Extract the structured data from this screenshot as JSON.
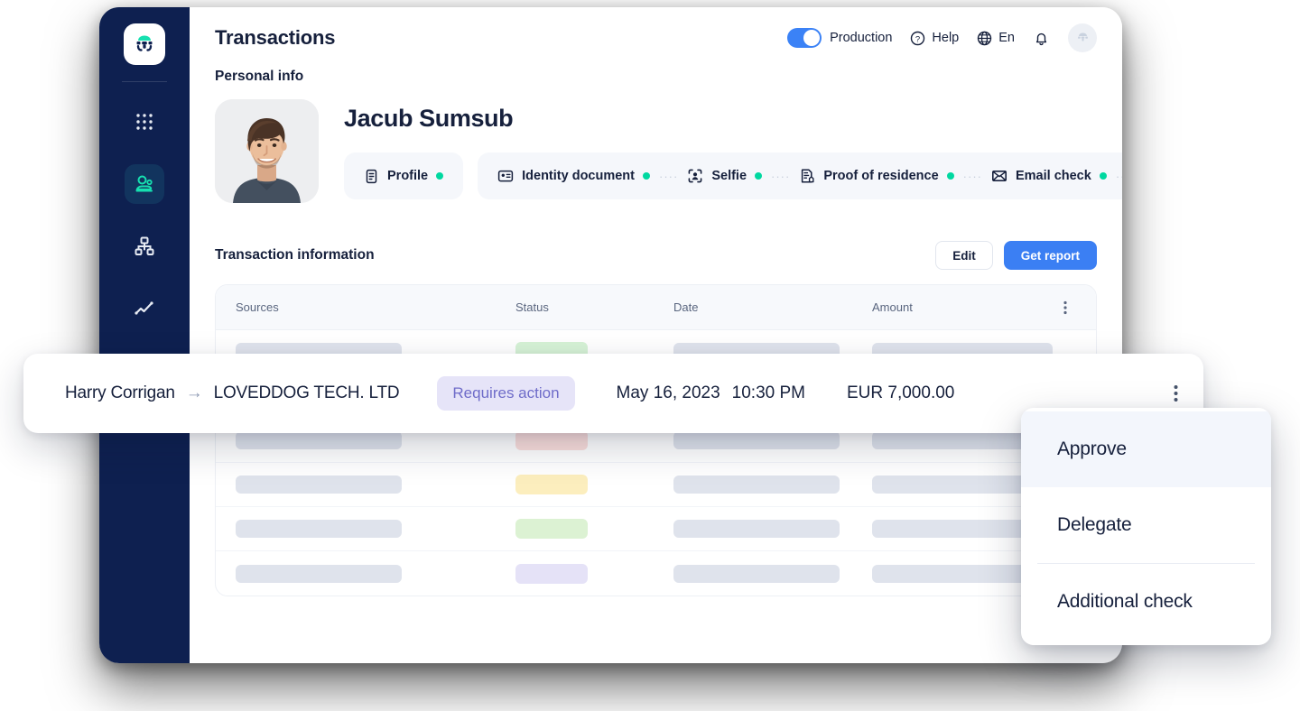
{
  "app": {
    "window_title": "Transactions"
  },
  "sidebar": {
    "logo_name": "sumsub-logo",
    "items": [
      {
        "icon": "apps-grid-icon",
        "name": "sidebar-item-apps",
        "active": false
      },
      {
        "icon": "applicants-icon",
        "name": "sidebar-item-applicants",
        "active": true
      },
      {
        "icon": "org-chart-icon",
        "name": "sidebar-item-workflow",
        "active": false
      },
      {
        "icon": "analytics-line-icon",
        "name": "sidebar-item-analytics",
        "active": false
      },
      {
        "icon": "gear-icon",
        "name": "sidebar-item-settings",
        "active": false
      }
    ]
  },
  "topbar": {
    "title": "Transactions",
    "env_toggle_label": "Production",
    "env_toggle_on": true,
    "help_label": "Help",
    "help_icon": "question-circle-icon",
    "language_label": "En",
    "language_icon": "globe-icon",
    "notifications_icon": "bell-icon",
    "account_avatar_icon": "sumsub-avatar-icon"
  },
  "personal_info": {
    "section_label": "Personal info",
    "name": "Jacub Sumsub",
    "photo_icon": "applicant-photo",
    "profile_chip": {
      "label": "Profile",
      "icon": "document-list-icon",
      "status_dot": "green"
    },
    "checks": [
      {
        "label": "Identity document",
        "icon": "id-card-icon",
        "status_dot": "green"
      },
      {
        "label": "Selfie",
        "icon": "face-scan-icon",
        "status_dot": "green"
      },
      {
        "label": "Proof of residence",
        "icon": "document-home-icon",
        "status_dot": "green"
      },
      {
        "label": "Email check",
        "icon": "envelope-icon",
        "status_dot": "green"
      }
    ],
    "separator": "····"
  },
  "transaction_section": {
    "title": "Transaction information",
    "edit_label": "Edit",
    "get_report_label": "Get report"
  },
  "table": {
    "columns": [
      "Sources",
      "Status",
      "Date",
      "Amount"
    ],
    "kebab_icon": "more-vertical-icon",
    "skeleton_rows": [
      {
        "status_color": "#D6F2D6"
      },
      {
        "status_color": "#D6F2D6"
      },
      {
        "status_color": "#FBDEDC"
      },
      {
        "status_color": "#FCEEBE"
      },
      {
        "status_color": "#DCF2D3"
      },
      {
        "status_color": "#E5E2F7"
      }
    ]
  },
  "floating_row": {
    "sender": "Harry Corrigan",
    "arrow": "→",
    "recipient": "LOVEDDOG TECH. LTD",
    "status": "Requires action",
    "status_bg": "#E6E4F8",
    "status_fg": "#6F6CC9",
    "date": "May 16, 2023",
    "time": "10:30 PM",
    "amount": "EUR 7,000.00",
    "kebab_icon": "more-vertical-icon"
  },
  "context_menu": {
    "items": [
      {
        "label": "Approve",
        "highlighted": true
      },
      {
        "label": "Delegate",
        "highlighted": false
      },
      {
        "label": "Additional check",
        "highlighted": false
      }
    ]
  },
  "colors": {
    "sidebar_bg": "#0E2050",
    "accent_blue": "#3B7FF3",
    "toggle_blue": "#3B82F6",
    "status_green_dot": "#00D8A0",
    "text_dark": "#16203C",
    "skeleton_grey": "#DFE3EC",
    "table_header_bg": "#F7F9FC",
    "chip_group_bg": "#F5F7FB"
  }
}
